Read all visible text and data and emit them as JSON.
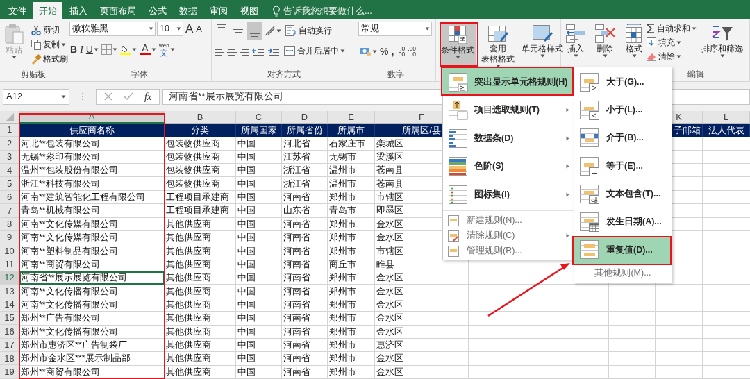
{
  "ribbon_tabs": [
    {
      "label": "文件",
      "selected": false
    },
    {
      "label": "开始",
      "selected": true
    },
    {
      "label": "插入",
      "selected": false
    },
    {
      "label": "页面布局",
      "selected": false
    },
    {
      "label": "公式",
      "selected": false
    },
    {
      "label": "数据",
      "selected": false
    },
    {
      "label": "审阅",
      "selected": false
    },
    {
      "label": "视图",
      "selected": false
    }
  ],
  "tell_me": {
    "placeholder": "告诉我您想要做什么..."
  },
  "clipboard": {
    "label": "剪贴板",
    "paste": {
      "label": "粘贴",
      "disabled": true
    },
    "cut": "剪切",
    "copy": "复制",
    "format_painter": "格式刷"
  },
  "font": {
    "label": "字体",
    "font_name": "微软雅黑",
    "font_size": "10",
    "grow": "A",
    "shrink": "A",
    "bold": "B",
    "italic": "I",
    "underline": "U",
    "font_color": "A",
    "phonetic_top": "wén",
    "phonetic_bottom": "文"
  },
  "alignment": {
    "label": "对齐方式",
    "vertical_align_buttons": [
      {
        "selected": false
      },
      {
        "selected": false
      },
      {
        "selected": true
      }
    ],
    "wrap_text": "自动换行",
    "merge_center": "合并后居中"
  },
  "number": {
    "label": "数字",
    "format": "常规",
    "percent": "%",
    "comma": ",",
    "increase_decimal": [
      ".0",
      ".00"
    ],
    "decrease_decimal": [
      ".00",
      ".0"
    ]
  },
  "styles": {
    "conditional_formatting": {
      "label": "条件格式",
      "pressed": true
    },
    "format_as_table": [
      "套用",
      "表格格式"
    ],
    "cell_styles": "单元格样式"
  },
  "cells": {
    "insert": "插入",
    "delete": "删除",
    "format": "格式"
  },
  "editing": {
    "label": "编辑",
    "autosum": "自动求和",
    "fill": "填充",
    "clear": "清除",
    "sort_filter": "排序和筛选"
  },
  "formula_bar": {
    "name_box": "A12",
    "function_label": "fx",
    "content": "河南省**展示展览有限公司"
  },
  "sheet": {
    "columns": [
      {
        "label": "A",
        "selected": true
      },
      {
        "label": "B",
        "selected": false
      },
      {
        "label": "C",
        "selected": false
      },
      {
        "label": "D",
        "selected": false
      },
      {
        "label": "E",
        "selected": false
      },
      {
        "label": "F",
        "selected": false
      },
      {
        "label": "K",
        "selected": false
      },
      {
        "label": "L",
        "selected": false
      }
    ],
    "header_row": {
      "number": "1",
      "cells": [
        "供应商名称",
        "分类",
        "所属国家",
        "所属省份",
        "所属市",
        "所属区/县",
        "子邮箱",
        "法人代表"
      ]
    },
    "rows": [
      {
        "number": "2",
        "selected": false,
        "cells": [
          "河北**包装有限公司",
          "包装物供应商",
          "中国",
          "河北省",
          "石家庄市",
          "栾城区"
        ]
      },
      {
        "number": "3",
        "selected": false,
        "cells": [
          "无锡**彩印有限公司",
          "包装物供应商",
          "中国",
          "江苏省",
          "无锡市",
          "梁溪区"
        ]
      },
      {
        "number": "4",
        "selected": false,
        "cells": [
          "温州**包装股份有限公司",
          "包装物供应商",
          "中国",
          "浙江省",
          "温州市",
          "苍南县"
        ]
      },
      {
        "number": "5",
        "selected": false,
        "cells": [
          "浙江**科技有限公司",
          "包装物供应商",
          "中国",
          "浙江省",
          "温州市",
          "苍南县"
        ]
      },
      {
        "number": "6",
        "selected": false,
        "cells": [
          "河南**建筑智能化工程有限公司",
          "工程项目承建商",
          "中国",
          "河南省",
          "郑州市",
          "市辖区"
        ]
      },
      {
        "number": "7",
        "selected": false,
        "cells": [
          "青岛**机械有限公司",
          "工程项目承建商",
          "中国",
          "山东省",
          "青岛市",
          "即墨区"
        ]
      },
      {
        "number": "8",
        "selected": false,
        "cells": [
          "河南**文化传媒有限公司",
          "其他供应商",
          "中国",
          "河南省",
          "郑州市",
          "金水区"
        ]
      },
      {
        "number": "9",
        "selected": false,
        "cells": [
          "河南**文化传媒有限公司",
          "其他供应商",
          "中国",
          "河南省",
          "郑州市",
          "金水区"
        ]
      },
      {
        "number": "10",
        "selected": false,
        "cells": [
          "河南**塑料制品有限公司",
          "其他供应商",
          "中国",
          "河南省",
          "郑州市",
          "市辖区"
        ]
      },
      {
        "number": "11",
        "selected": false,
        "cells": [
          "河南**商贸有限公司",
          "其他供应商",
          "中国",
          "河南省",
          "商丘市",
          "睢县"
        ]
      },
      {
        "number": "12",
        "selected": true,
        "cells": [
          "河南省**展示展览有限公司",
          "其他供应商",
          "中国",
          "河南省",
          "郑州市",
          "金水区"
        ]
      },
      {
        "number": "13",
        "selected": false,
        "cells": [
          "河南**文化传播有限公司",
          "其他供应商",
          "中国",
          "河南省",
          "郑州市",
          "金水区"
        ]
      },
      {
        "number": "14",
        "selected": false,
        "cells": [
          "河南**文化传播有限公司",
          "其他供应商",
          "中国",
          "河南省",
          "郑州市",
          "金水区"
        ]
      },
      {
        "number": "15",
        "selected": false,
        "cells": [
          "郑州**广告有限公司",
          "其他供应商",
          "中国",
          "河南省",
          "郑州市",
          "金水区"
        ]
      },
      {
        "number": "16",
        "selected": false,
        "cells": [
          "郑州**文化传播有限公司",
          "其他供应商",
          "中国",
          "河南省",
          "郑州市",
          "金水区"
        ]
      },
      {
        "number": "17",
        "selected": false,
        "cells": [
          "郑州市惠济区**广告制袋厂",
          "其他供应商",
          "中国",
          "河南省",
          "郑州市",
          "惠济区"
        ]
      },
      {
        "number": "18",
        "selected": false,
        "cells": [
          "郑州市金水区***展示制品部",
          "其他供应商",
          "中国",
          "河南省",
          "郑州市",
          "金水区"
        ]
      },
      {
        "number": "19",
        "selected": false,
        "cells": [
          "郑州**商贸有限公司",
          "其他供应商",
          "中国",
          "河南省",
          "郑州市",
          "金水区"
        ]
      }
    ]
  },
  "conditional_menu": {
    "items": [
      {
        "label": "突出显示单元格规则(H)",
        "kind": "large",
        "selected": true,
        "submenu": true
      },
      {
        "label": "项目选取规则(T)",
        "kind": "large",
        "selected": false,
        "submenu": true
      },
      {
        "label": "数据条(D)",
        "kind": "large",
        "selected": false,
        "submenu": true
      },
      {
        "label": "色阶(S)",
        "kind": "large",
        "selected": false,
        "submenu": true
      },
      {
        "label": "图标集(I)",
        "kind": "large",
        "selected": false,
        "submenu": true
      },
      {
        "label": "新建规则(N)...",
        "kind": "small",
        "selected": false,
        "submenu": false
      },
      {
        "label": "清除规则(C)",
        "kind": "small",
        "selected": false,
        "submenu": true
      },
      {
        "label": "管理规则(R)...",
        "kind": "small",
        "selected": false,
        "submenu": false
      }
    ]
  },
  "highlight_submenu": {
    "items": [
      {
        "label": "大于(G)...",
        "kind": "large",
        "selected": false
      },
      {
        "label": "小于(L)...",
        "kind": "large",
        "selected": false
      },
      {
        "label": "介于(B)...",
        "kind": "large",
        "selected": false
      },
      {
        "label": "等于(E)...",
        "kind": "large",
        "selected": false
      },
      {
        "label": "文本包含(T)...",
        "kind": "large",
        "selected": false
      },
      {
        "label": "发生日期(A)...",
        "kind": "large",
        "selected": false
      },
      {
        "label": "重复值(D)...",
        "kind": "large",
        "selected": true
      },
      {
        "label": "其他规则(M)...",
        "kind": "footer",
        "selected": false
      }
    ]
  }
}
